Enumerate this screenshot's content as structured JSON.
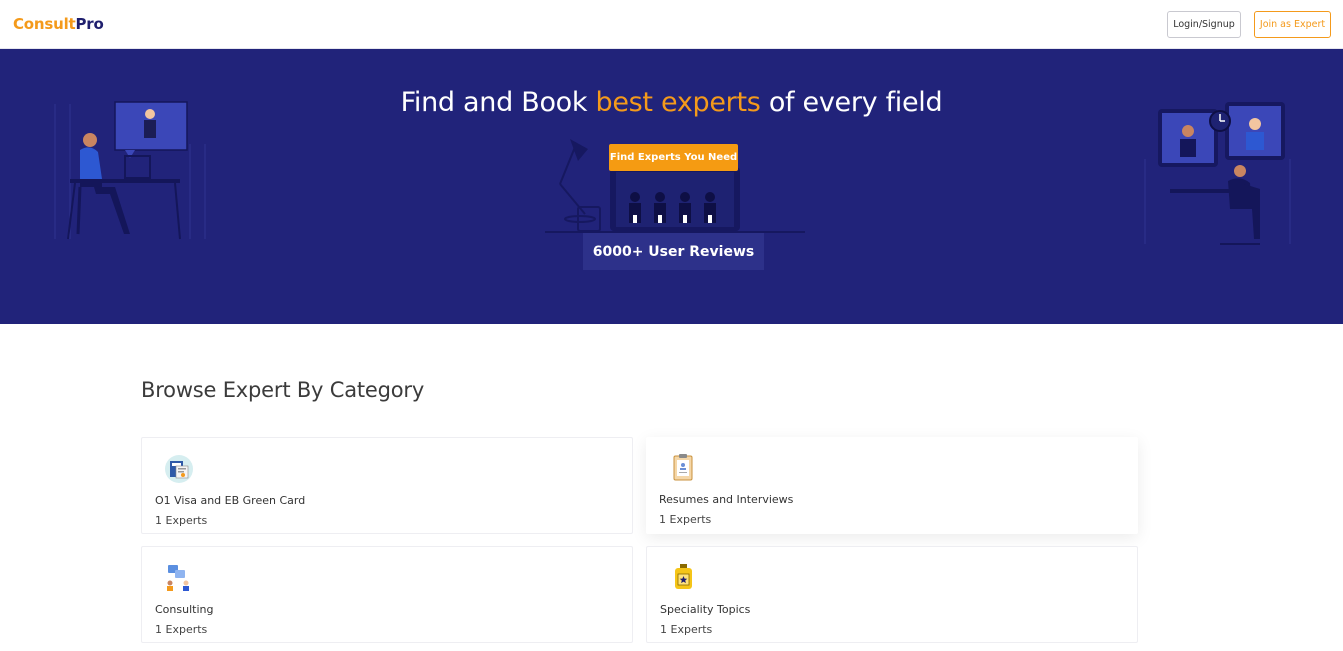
{
  "brand": {
    "part1": "Consult",
    "part2": "Pro"
  },
  "header": {
    "login_label": "Login/Signup",
    "join_label": "Join as Expert"
  },
  "hero": {
    "title_before": "Find and Book ",
    "title_highlight": "best experts",
    "title_after": " of every field",
    "cta_label": "Find Experts You Need",
    "reviews_label": "6000+ User Reviews"
  },
  "categories_section": {
    "title": "Browse Expert By Category",
    "items": [
      {
        "name": "O1 Visa and EB Green Card",
        "count": "1 Experts",
        "icon": "visa-document-icon"
      },
      {
        "name": "Resumes and Interviews",
        "count": "1 Experts",
        "icon": "clipboard-resume-icon"
      },
      {
        "name": "Consulting",
        "count": "1 Experts",
        "icon": "consulting-chat-icon"
      },
      {
        "name": "Speciality Topics",
        "count": "1 Experts",
        "icon": "badge-star-icon"
      }
    ]
  },
  "colors": {
    "brand_orange": "#f49a1b",
    "hero_bg": "#21237a",
    "navy": "#1f1f6e"
  }
}
